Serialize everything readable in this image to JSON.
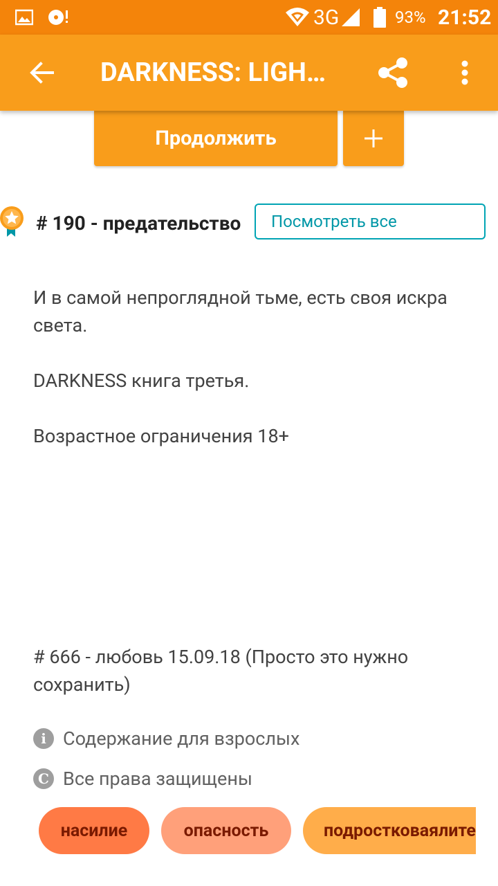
{
  "status_bar": {
    "network": "3G",
    "battery": "93%",
    "time": "21:52",
    "icons": [
      "image-icon",
      "disc-icon",
      "wifi-icon",
      "signal-icon",
      "battery-icon"
    ]
  },
  "app_bar": {
    "title": "DARKNESS: LIGH…",
    "icons": [
      "back-arrow-icon",
      "share-icon",
      "more-vert-icon"
    ]
  },
  "actions": {
    "continue_label": "Продолжить",
    "add_label": "+"
  },
  "ranking": {
    "text": "# 190 - предательство",
    "view_all_label": "Посмотреть все"
  },
  "description": {
    "line1": "И в самой непроглядной тьме, есть своя искра света.",
    "line2": "DARKNESS книга третья.",
    "line3": "Возрастное ограничения 18+",
    "line4": "# 666 - любовь 15.09.18 (Просто это нужно сохранить)"
  },
  "info": {
    "mature": "Содержание для взрослых",
    "copyright": "Все права защищены"
  },
  "tags": [
    "насилие",
    "опасность",
    "подростковаялитература"
  ],
  "colors": {
    "status_bar": "#f4840a",
    "app_bar": "#f99d1b",
    "accent_teal": "#00a4b4",
    "tag1": "#ff7a45",
    "tag2": "#ffa07a",
    "tag3": "#ffad4a"
  }
}
